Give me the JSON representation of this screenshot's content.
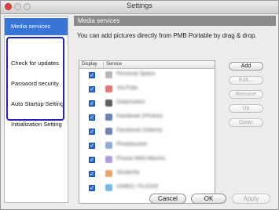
{
  "window": {
    "title": "Settings"
  },
  "sidebar": {
    "items": [
      {
        "label": "Media services",
        "active": true
      },
      {
        "label": "Check for updates",
        "active": false
      },
      {
        "label": "Password security",
        "active": false
      },
      {
        "label": "Auto Startup Setting",
        "active": false
      },
      {
        "label": "Initialization Setting",
        "active": false
      }
    ],
    "highlight_color": "#2323b8",
    "selection_color": "#3875d7"
  },
  "main": {
    "section_title": "Media services",
    "description": "You can add pictures directly from PMB Portable by drag & drop.",
    "table": {
      "columns": [
        "Display",
        "Service"
      ],
      "rows": [
        {
          "checked": true,
          "name": "Personal Space",
          "icon": "personal-space-icon",
          "icon_color": "#a0a0a0"
        },
        {
          "checked": true,
          "name": "YouTube",
          "icon": "youtube-icon",
          "icon_color": "#d84a4a"
        },
        {
          "checked": true,
          "name": "Dailymotion",
          "icon": "dailymotion-icon",
          "icon_color": "#2b2b2b"
        },
        {
          "checked": true,
          "name": "Facebook (Photos)",
          "icon": "facebook-photos-icon",
          "icon_color": "#3b5998"
        },
        {
          "checked": true,
          "name": "Facebook (Videos)",
          "icon": "facebook-videos-icon",
          "icon_color": "#3b5998"
        },
        {
          "checked": true,
          "name": "Photobucket",
          "icon": "photobucket-icon",
          "icon_color": "#6a90c8"
        },
        {
          "checked": true,
          "name": "Picasa Web Albums",
          "icon": "picasa-icon",
          "icon_color": "#9a7bd0"
        },
        {
          "checked": true,
          "name": "Shutterfly",
          "icon": "shutterfly-icon",
          "icon_color": "#e08a3a"
        },
        {
          "checked": true,
          "name": "VIMEO / FLICKR",
          "icon": "vimeo-icon",
          "icon_color": "#4aa3d8"
        }
      ]
    },
    "side_buttons": [
      {
        "label": "Add",
        "enabled": true
      },
      {
        "label": "Edit...",
        "enabled": false
      },
      {
        "label": "Remove",
        "enabled": false
      },
      {
        "label": "Up",
        "enabled": false
      },
      {
        "label": "Down",
        "enabled": false
      }
    ]
  },
  "footer": {
    "cancel_label": "Cancel",
    "ok_label": "OK",
    "apply_label": "Apply"
  }
}
